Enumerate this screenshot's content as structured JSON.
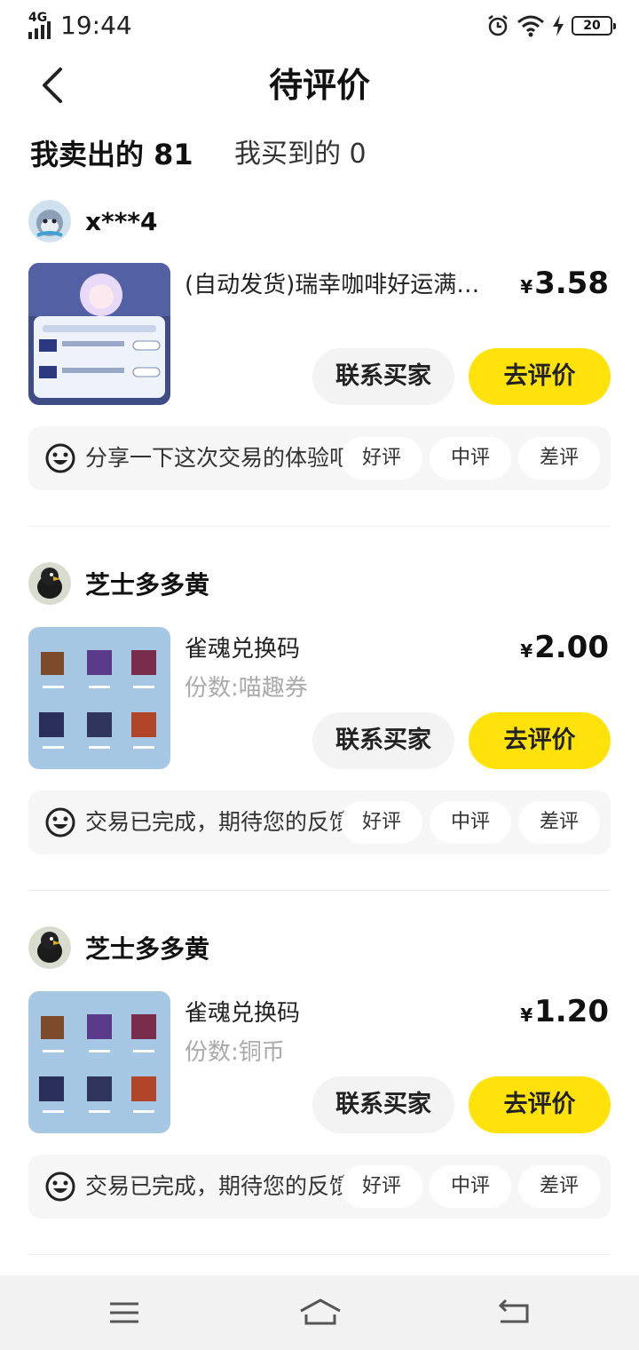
{
  "status_bar": {
    "network": "4G",
    "time": "19:44",
    "battery": "20"
  },
  "header": {
    "title": "待评价"
  },
  "tabs": {
    "sold_label": "我卖出的 81",
    "bought_label": "我买到的 0"
  },
  "currency_symbol": "¥",
  "rating_labels": {
    "good": "好评",
    "mid": "中评",
    "bad": "差评"
  },
  "actions": {
    "contact": "联系买家",
    "review": "去评价"
  },
  "orders": [
    {
      "buyer_name": "x***4",
      "product_title": "(自动发货)瑞幸咖啡好运满…",
      "product_sub": "",
      "price": "3.58",
      "feedback_prompt": "分享一下这次交易的体验吧"
    },
    {
      "buyer_name": "芝士多多黄",
      "product_title": "雀魂兑换码",
      "product_sub": "份数:喵趣券",
      "price": "2.00",
      "feedback_prompt": "交易已完成，期待您的反馈"
    },
    {
      "buyer_name": "芝士多多黄",
      "product_title": "雀魂兑换码",
      "product_sub": "份数:铜币",
      "price": "1.20",
      "feedback_prompt": "交易已完成，期待您的反馈"
    }
  ],
  "colors": {
    "accent_yellow": "#ffe20a",
    "tab_highlight": "#ffe42e",
    "chip_bg": "#f3f3f3"
  },
  "icons": [
    "signal-icon",
    "alarm-icon",
    "wifi-icon",
    "charging-icon",
    "battery-icon",
    "back-arrow-icon",
    "smile-face-icon",
    "menu-icon",
    "home-icon",
    "return-icon"
  ]
}
